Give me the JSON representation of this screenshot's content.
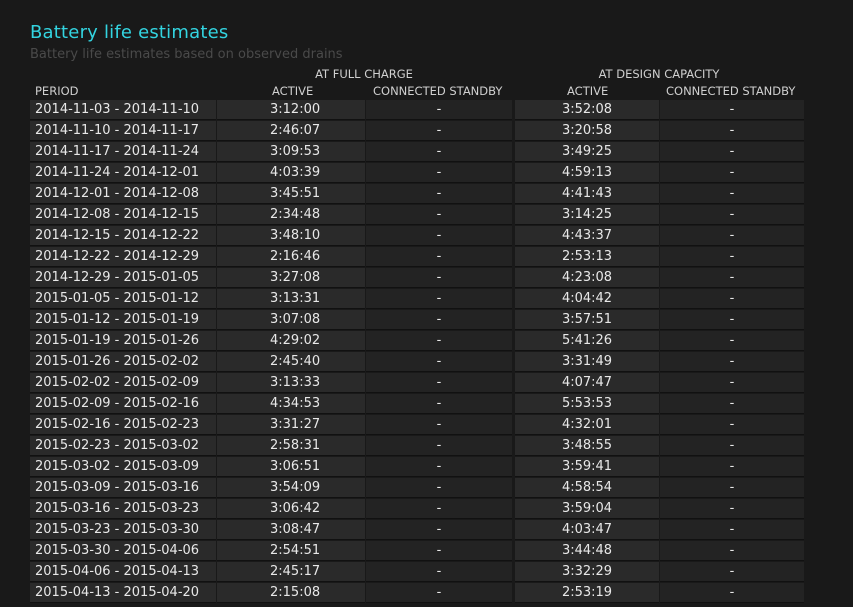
{
  "report": {
    "title": "Battery life estimates",
    "subtitle": "Battery life estimates based on observed drains"
  },
  "table": {
    "group_full": "AT FULL CHARGE",
    "group_design": "AT DESIGN CAPACITY",
    "columns": {
      "period": "PERIOD",
      "active_full": "ACTIVE",
      "standby_full": "CONNECTED STANDBY",
      "active_design": "ACTIVE",
      "standby_design": "CONNECTED STANDBY"
    },
    "rows": [
      {
        "period": "2014-11-03 - 2014-11-10",
        "active_full": "3:12:00",
        "standby_full": "-",
        "active_design": "3:52:08",
        "standby_design": "-"
      },
      {
        "period": "2014-11-10 - 2014-11-17",
        "active_full": "2:46:07",
        "standby_full": "-",
        "active_design": "3:20:58",
        "standby_design": "-"
      },
      {
        "period": "2014-11-17 - 2014-11-24",
        "active_full": "3:09:53",
        "standby_full": "-",
        "active_design": "3:49:25",
        "standby_design": "-"
      },
      {
        "period": "2014-11-24 - 2014-12-01",
        "active_full": "4:03:39",
        "standby_full": "-",
        "active_design": "4:59:13",
        "standby_design": "-"
      },
      {
        "period": "2014-12-01 - 2014-12-08",
        "active_full": "3:45:51",
        "standby_full": "-",
        "active_design": "4:41:43",
        "standby_design": "-"
      },
      {
        "period": "2014-12-08 - 2014-12-15",
        "active_full": "2:34:48",
        "standby_full": "-",
        "active_design": "3:14:25",
        "standby_design": "-"
      },
      {
        "period": "2014-12-15 - 2014-12-22",
        "active_full": "3:48:10",
        "standby_full": "-",
        "active_design": "4:43:37",
        "standby_design": "-"
      },
      {
        "period": "2014-12-22 - 2014-12-29",
        "active_full": "2:16:46",
        "standby_full": "-",
        "active_design": "2:53:13",
        "standby_design": "-"
      },
      {
        "period": "2014-12-29 - 2015-01-05",
        "active_full": "3:27:08",
        "standby_full": "-",
        "active_design": "4:23:08",
        "standby_design": "-"
      },
      {
        "period": "2015-01-05 - 2015-01-12",
        "active_full": "3:13:31",
        "standby_full": "-",
        "active_design": "4:04:42",
        "standby_design": "-"
      },
      {
        "period": "2015-01-12 - 2015-01-19",
        "active_full": "3:07:08",
        "standby_full": "-",
        "active_design": "3:57:51",
        "standby_design": "-"
      },
      {
        "period": "2015-01-19 - 2015-01-26",
        "active_full": "4:29:02",
        "standby_full": "-",
        "active_design": "5:41:26",
        "standby_design": "-"
      },
      {
        "period": "2015-01-26 - 2015-02-02",
        "active_full": "2:45:40",
        "standby_full": "-",
        "active_design": "3:31:49",
        "standby_design": "-"
      },
      {
        "period": "2015-02-02 - 2015-02-09",
        "active_full": "3:13:33",
        "standby_full": "-",
        "active_design": "4:07:47",
        "standby_design": "-"
      },
      {
        "period": "2015-02-09 - 2015-02-16",
        "active_full": "4:34:53",
        "standby_full": "-",
        "active_design": "5:53:53",
        "standby_design": "-"
      },
      {
        "period": "2015-02-16 - 2015-02-23",
        "active_full": "3:31:27",
        "standby_full": "-",
        "active_design": "4:32:01",
        "standby_design": "-"
      },
      {
        "period": "2015-02-23 - 2015-03-02",
        "active_full": "2:58:31",
        "standby_full": "-",
        "active_design": "3:48:55",
        "standby_design": "-"
      },
      {
        "period": "2015-03-02 - 2015-03-09",
        "active_full": "3:06:51",
        "standby_full": "-",
        "active_design": "3:59:41",
        "standby_design": "-"
      },
      {
        "period": "2015-03-09 - 2015-03-16",
        "active_full": "3:54:09",
        "standby_full": "-",
        "active_design": "4:58:54",
        "standby_design": "-"
      },
      {
        "period": "2015-03-16 - 2015-03-23",
        "active_full": "3:06:42",
        "standby_full": "-",
        "active_design": "3:59:04",
        "standby_design": "-"
      },
      {
        "period": "2015-03-23 - 2015-03-30",
        "active_full": "3:08:47",
        "standby_full": "-",
        "active_design": "4:03:47",
        "standby_design": "-"
      },
      {
        "period": "2015-03-30 - 2015-04-06",
        "active_full": "2:54:51",
        "standby_full": "-",
        "active_design": "3:44:48",
        "standby_design": "-"
      },
      {
        "period": "2015-04-06 - 2015-04-13",
        "active_full": "2:45:17",
        "standby_full": "-",
        "active_design": "3:32:29",
        "standby_design": "-"
      },
      {
        "period": "2015-04-13 - 2015-04-20",
        "active_full": "2:15:08",
        "standby_full": "-",
        "active_design": "2:53:19",
        "standby_design": "-"
      }
    ]
  },
  "colors": {
    "title": "#33d4e0",
    "subtitle": "#4a4a4a",
    "background": "#191919",
    "cell_dark": "#2a2a2a",
    "cell_darker": "#232323"
  }
}
